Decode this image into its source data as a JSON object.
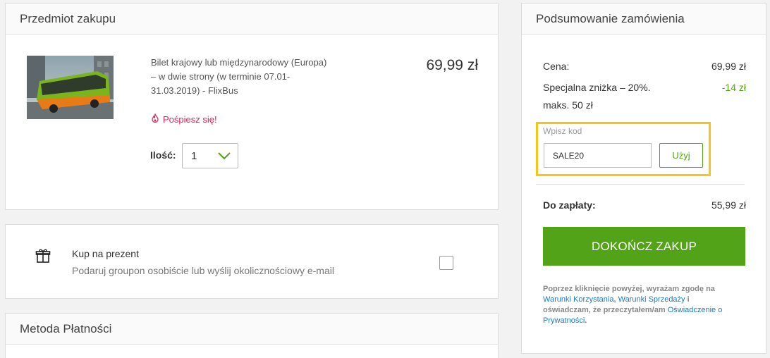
{
  "item_section": {
    "title": "Przedmiot zakupu",
    "description": "Bilet krajowy lub międzynarodowy (Europa) – w dwie strony (w terminie 07.01-31.03.2019) - FlixBus",
    "price": "69,99 zł",
    "hurry_text": "Pośpiesz się!",
    "quantity_label": "Ilość:",
    "quantity_value": "1"
  },
  "gift_section": {
    "title": "Kup na prezent",
    "subtitle": "Podaruj groupon osobiście lub wyślij okolicznościowy e-mail",
    "checked": false
  },
  "payment_section": {
    "title": "Metoda Płatności"
  },
  "summary": {
    "title": "Podsumowanie zamówienia",
    "price_label": "Cena:",
    "price_value": "69,99 zł",
    "discount_label": "Specjalna zniżka – 20%. maks. 50 zł",
    "discount_value": "-14 zł",
    "code_label": "Wpisz kod",
    "code_value": "SALE20",
    "apply_label": "Użyj",
    "total_label": "Do zapłaty:",
    "total_value": "55,99 zł",
    "checkout_label": "DOKOŃCZ ZAKUP",
    "legal_prefix": "Poprzez kliknięcie powyżej, wyrażam zgodę na",
    "terms_of_use": "Warunki Korzystania",
    "comma": ", ",
    "terms_of_sale": "Warunki Sprzedaży",
    "legal_middle": " i oświadczam, że przeczytałem/am ",
    "privacy": "Oświadczenie o Prywatności",
    "period": "."
  },
  "colors": {
    "accent_green": "#53a318",
    "highlight_yellow": "#f5c518",
    "hurry_red": "#e02255",
    "link_blue": "#1b7ac9"
  },
  "icons": {
    "hurry": "flame-icon",
    "gift": "gift-icon",
    "dropdown": "chevron-down-icon"
  }
}
